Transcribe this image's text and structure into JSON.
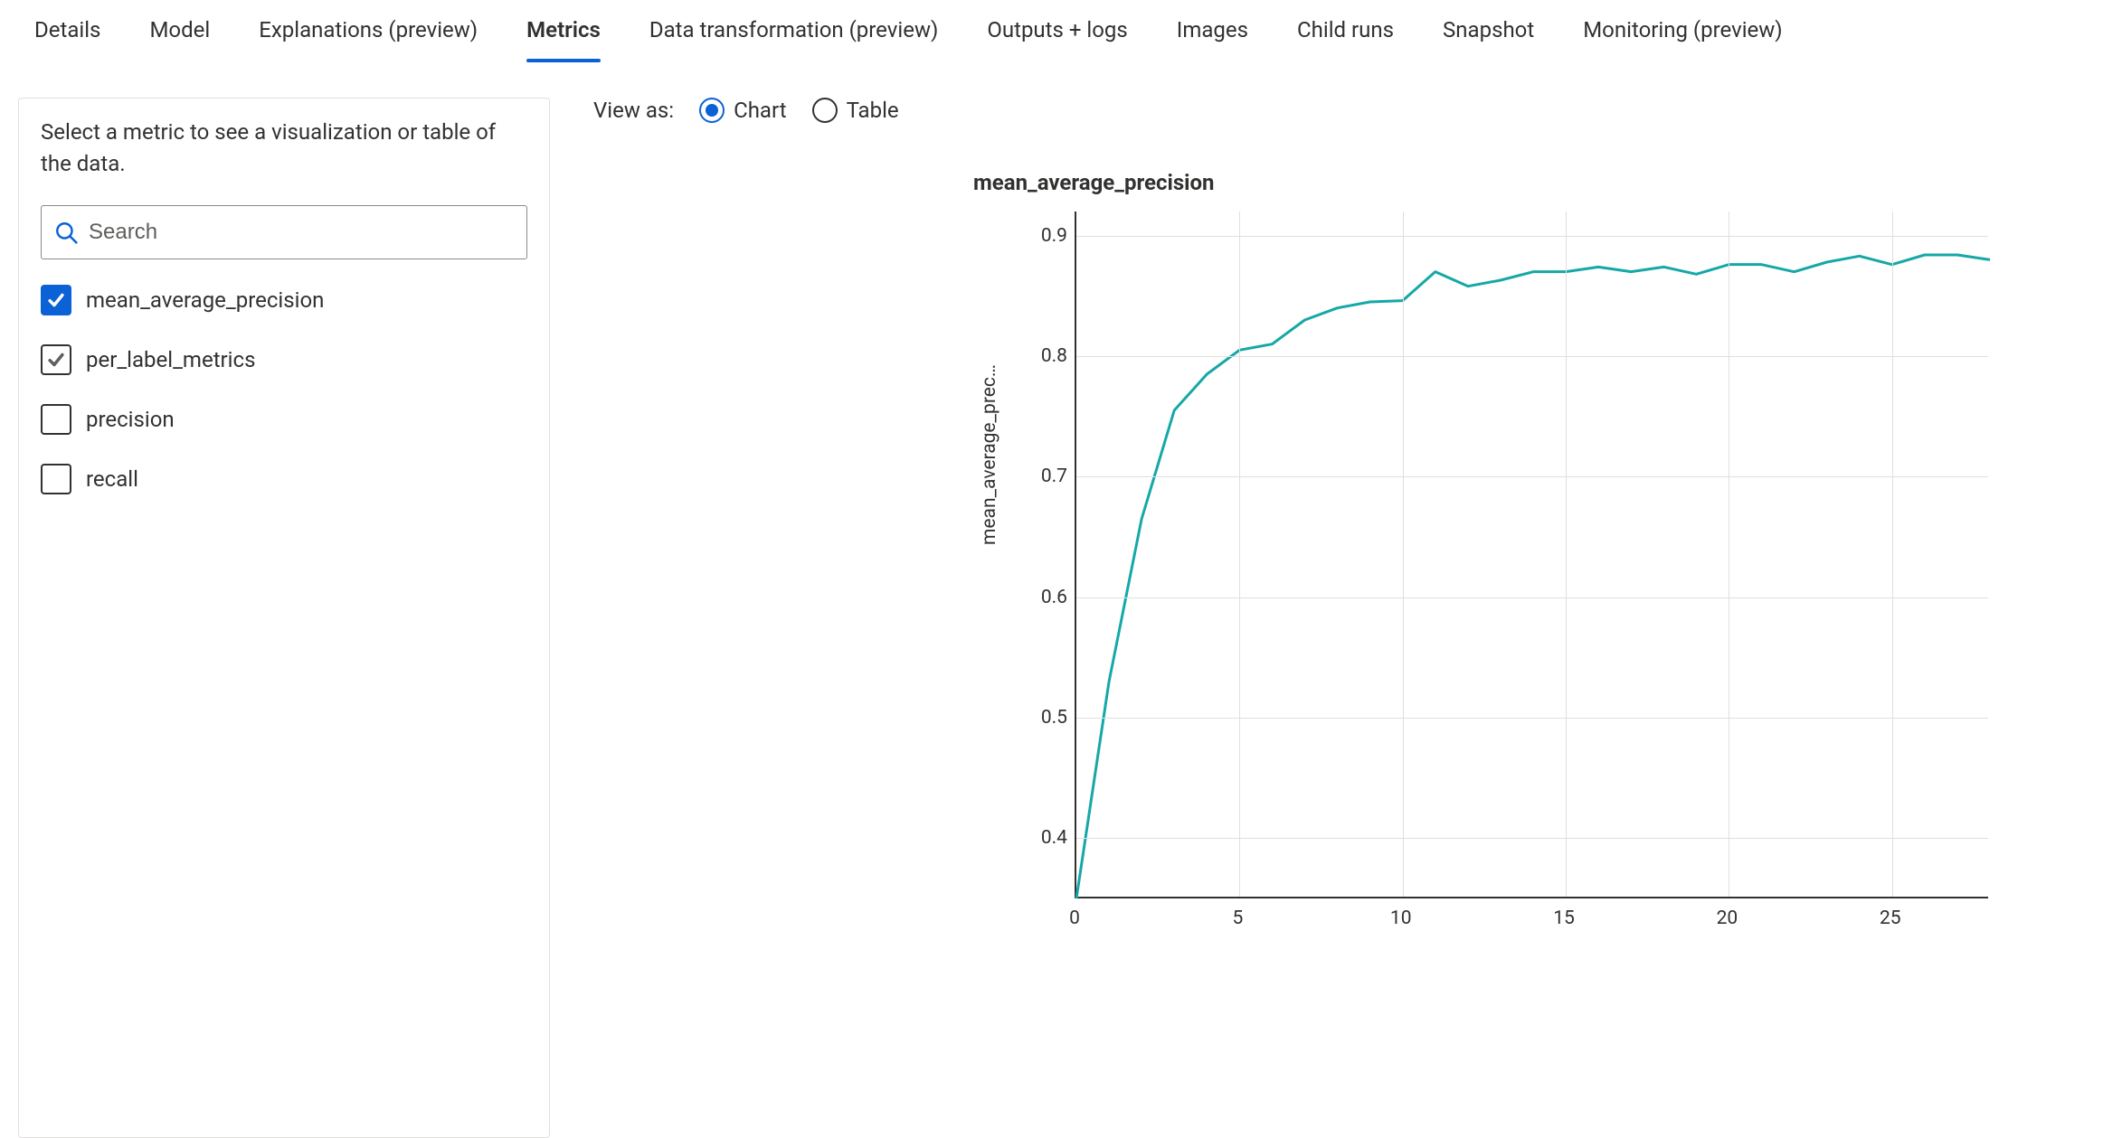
{
  "tabs": [
    {
      "label": "Details",
      "active": false
    },
    {
      "label": "Model",
      "active": false
    },
    {
      "label": "Explanations (preview)",
      "active": false
    },
    {
      "label": "Metrics",
      "active": true
    },
    {
      "label": "Data transformation (preview)",
      "active": false
    },
    {
      "label": "Outputs + logs",
      "active": false
    },
    {
      "label": "Images",
      "active": false
    },
    {
      "label": "Child runs",
      "active": false
    },
    {
      "label": "Snapshot",
      "active": false
    },
    {
      "label": "Monitoring (preview)",
      "active": false
    }
  ],
  "sidebar": {
    "instruction": "Select a metric to see a visualization or table of the data.",
    "search_placeholder": "Search",
    "metrics": [
      {
        "label": "mean_average_precision",
        "state": "checked-primary"
      },
      {
        "label": "per_label_metrics",
        "state": "checked-outline"
      },
      {
        "label": "precision",
        "state": "unchecked"
      },
      {
        "label": "recall",
        "state": "unchecked"
      }
    ]
  },
  "viewas": {
    "label": "View as:",
    "options": [
      {
        "label": "Chart",
        "selected": true
      },
      {
        "label": "Table",
        "selected": false
      }
    ]
  },
  "colors": {
    "series": "#16a7a7"
  },
  "chart_data": {
    "type": "line",
    "title": "mean_average_precision",
    "ylabel": "mean_average_prec…",
    "xlabel": "",
    "ylim": [
      0.35,
      0.92
    ],
    "xlim": [
      0,
      28
    ],
    "y_ticks": [
      0.4,
      0.5,
      0.6,
      0.7,
      0.8,
      0.9
    ],
    "x_ticks": [
      0,
      5,
      10,
      15,
      20,
      25
    ],
    "x": [
      0,
      1,
      2,
      3,
      4,
      5,
      6,
      7,
      8,
      9,
      10,
      11,
      12,
      13,
      14,
      15,
      16,
      17,
      18,
      19,
      20,
      21,
      22,
      23,
      24,
      25,
      26,
      27,
      28
    ],
    "values": [
      0.35,
      0.53,
      0.665,
      0.755,
      0.785,
      0.805,
      0.81,
      0.83,
      0.84,
      0.845,
      0.846,
      0.87,
      0.858,
      0.863,
      0.87,
      0.87,
      0.874,
      0.87,
      0.874,
      0.868,
      0.876,
      0.876,
      0.87,
      0.878,
      0.883,
      0.876,
      0.884,
      0.884,
      0.88
    ]
  }
}
